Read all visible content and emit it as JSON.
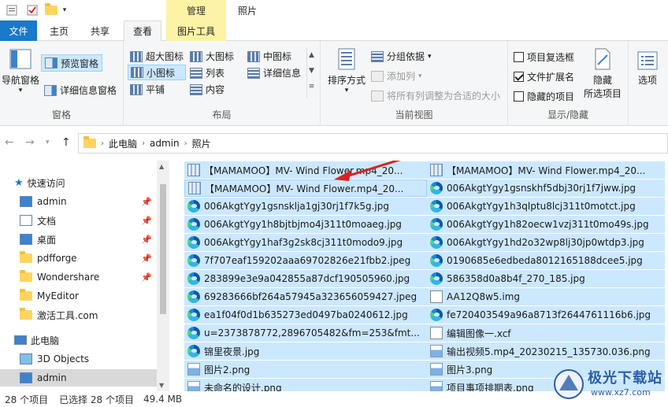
{
  "titlebar": {
    "context_tab": "管理",
    "title": "照片"
  },
  "tabs": {
    "file": "文件",
    "home": "主页",
    "share": "共享",
    "view": "查看",
    "picture_tools": "图片工具"
  },
  "ribbon": {
    "panes": {
      "label": "窗格",
      "nav_pane": "导航窗格",
      "preview_pane": "预览窗格",
      "details_pane": "详细信息窗格"
    },
    "layout": {
      "label": "布局",
      "extra_large": "超大图标",
      "large": "大图标",
      "medium": "中图标",
      "small": "小图标",
      "list": "列表",
      "details": "详细信息",
      "tiles": "平铺",
      "content": "内容"
    },
    "current_view": {
      "label": "当前视图",
      "sort_by": "排序方式",
      "group_by": "分组依据",
      "add_columns": "添加列",
      "fit_columns": "将所有列调整为合适的大小"
    },
    "show_hide": {
      "label": "显示/隐藏",
      "item_checkboxes": "项目复选框",
      "item_checkboxes_checked": false,
      "file_extensions": "文件扩展名",
      "file_extensions_checked": true,
      "hidden_items": "隐藏的项目",
      "hidden_items_checked": false,
      "hide_selected": "隐藏",
      "hide_selected_2": "所选项目",
      "options": "选项"
    }
  },
  "address": {
    "crumbs": [
      "此电脑",
      "admin",
      "照片"
    ]
  },
  "sidebar": {
    "quick_access": "快速访问",
    "items": [
      {
        "label": "admin",
        "pinned": true
      },
      {
        "label": "文档",
        "pinned": true
      },
      {
        "label": "桌面",
        "pinned": true
      },
      {
        "label": "pdfforge",
        "pinned": true
      },
      {
        "label": "Wondershare",
        "pinned": true
      },
      {
        "label": "MyEditor",
        "pinned": false
      },
      {
        "label": "激活工具.com",
        "pinned": false
      }
    ],
    "this_pc": "此电脑",
    "pc_items": [
      {
        "label": "3D Objects"
      },
      {
        "label": "admin"
      }
    ]
  },
  "files": {
    "left": [
      {
        "name": "【MAMAMOO】MV- Wind Flower.mp4_20...",
        "type": "vid"
      },
      {
        "name": "【MAMAMOO】MV- Wind Flower.mp4_20...",
        "type": "vid"
      },
      {
        "name": "006AkgtYgy1gsnskljа1gj30rj1f7k5g.jpg",
        "type": "edge"
      },
      {
        "name": "006AkgtYgy1h8bjtbjmo4j311t0moaeg.jpg",
        "type": "edge"
      },
      {
        "name": "006AkgtYgy1haf3g2sk8cj311t0modo9.jpg",
        "type": "edge"
      },
      {
        "name": "7f707eaf159202aaa69702826e21fbb2.jpeg",
        "type": "edge"
      },
      {
        "name": "283899e3e9a042855a87dcf190505960.jpg",
        "type": "edge"
      },
      {
        "name": "69283666bf264a57945a323656059427.jpeg",
        "type": "edge"
      },
      {
        "name": "ea1f04f0d1b635273ed0497ba0240612.jpg",
        "type": "edge"
      },
      {
        "name": "u=2373878772,2896705482&fm=253&fmt...",
        "type": "edge"
      },
      {
        "name": "锦里夜景.jpg",
        "type": "edge"
      },
      {
        "name": "图片2.png",
        "type": "png"
      },
      {
        "name": "未命名的设计.png",
        "type": "png"
      }
    ],
    "right": [
      {
        "name": "【MAMAMOO】MV- Wind Flower.mp4_20...",
        "type": "vid"
      },
      {
        "name": "006AkgtYgy1gsnskhf5dbj30rj1f7jww.jpg",
        "type": "edge"
      },
      {
        "name": "006AkgtYgy1h3qlptu8lcj311t0motct.jpg",
        "type": "edge"
      },
      {
        "name": "006AkgtYgy1h82oecw1vzj311t0mo49s.jpg",
        "type": "edge"
      },
      {
        "name": "006AkgtYgy1hd2o32wp8lj30jp0wtdp3.jpg",
        "type": "edge"
      },
      {
        "name": "0190685e6edbeda8012165188dcee5.jpg",
        "type": "edge"
      },
      {
        "name": "586358d0a8b4f_270_185.jpg",
        "type": "edge"
      },
      {
        "name": "AA12Q8w5.img",
        "type": "doc"
      },
      {
        "name": "fe720403549a96a8713f2644761116b6.jpg",
        "type": "edge"
      },
      {
        "name": "编辑图像一.xcf",
        "type": "doc"
      },
      {
        "name": "输出视频5.mp4_20230215_135730.036.png",
        "type": "png"
      },
      {
        "name": "图片3.png",
        "type": "png"
      },
      {
        "name": "项目事项排期表.png",
        "type": "png"
      }
    ]
  },
  "status": {
    "count": "28 个项目",
    "selected": "已选择 28 个项目",
    "size": "49.4 MB"
  },
  "watermark": {
    "text": "极光下载站",
    "url": "www.xz7.com"
  },
  "colors": {
    "file_tab": "#1979ca",
    "context_tab": "#fcf3a5",
    "selection": "#cce8ff",
    "arrow": "#d9231f"
  }
}
